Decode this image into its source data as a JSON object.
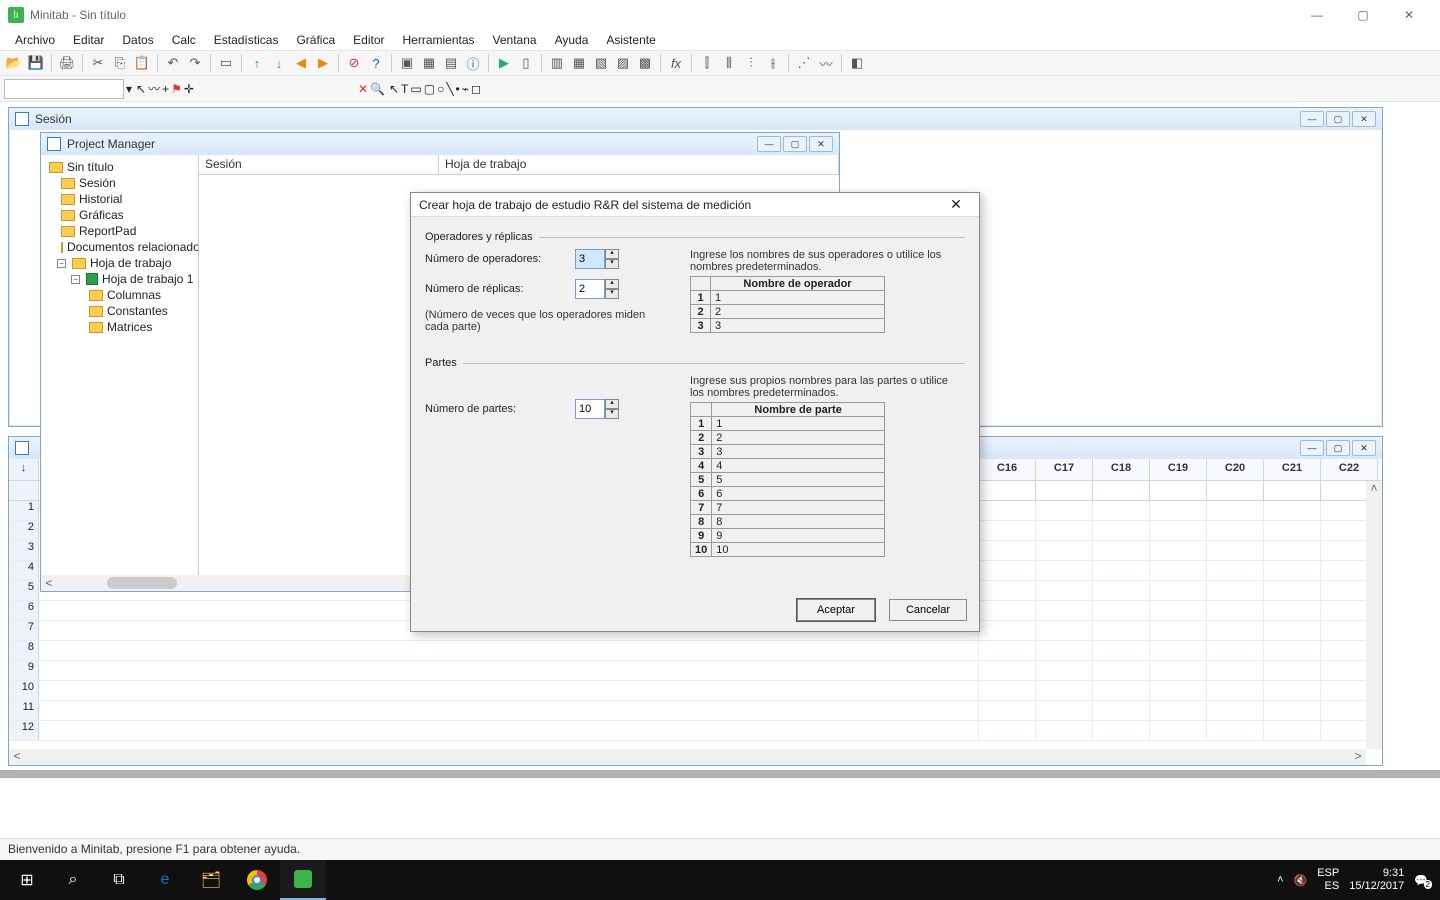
{
  "titlebar": {
    "app": "Minitab",
    "doc": "Sin título"
  },
  "menu": [
    "Archivo",
    "Editar",
    "Datos",
    "Calc",
    "Estadísticas",
    "Gráfica",
    "Editor",
    "Herramientas",
    "Ventana",
    "Ayuda",
    "Asistente"
  ],
  "session": {
    "title": "Sesión"
  },
  "project_manager": {
    "title": "Project Manager",
    "columns": [
      "Sesión",
      "Hoja de trabajo"
    ],
    "tree": {
      "root": "Sin título",
      "n1": "Sesión",
      "n2": "Historial",
      "n3": "Gráficas",
      "n4": "ReportPad",
      "n5": "Documentos relacionados",
      "n6": "Hoja de trabajo",
      "n6a": "Hoja de trabajo 1",
      "n6a1": "Columnas",
      "n6a2": "Constantes",
      "n6a3": "Matrices"
    }
  },
  "worksheet": {
    "cols": [
      "C16",
      "C17",
      "C18",
      "C19",
      "C20",
      "C21",
      "C22"
    ],
    "rows": [
      "1",
      "2",
      "3",
      "4",
      "5",
      "6",
      "7",
      "8",
      "9",
      "10",
      "11",
      "12"
    ]
  },
  "dialog": {
    "title": "Crear hoja de trabajo de estudio R&R del sistema de medición",
    "section1": "Operadores y réplicas",
    "num_operators_label": "Número de operadores:",
    "num_operators": "3",
    "num_replicas_label": "Número de réplicas:",
    "num_replicas": "2",
    "replicas_note": "(Número de veces que los operadores miden cada parte)",
    "operators_hint": "Ingrese los nombres de sus operadores o utilice los nombres predeterminados.",
    "operator_header": "Nombre de operador",
    "operators": [
      "1",
      "2",
      "3"
    ],
    "section2": "Partes",
    "num_parts_label": "Número de partes:",
    "num_parts": "10",
    "parts_hint": "Ingrese sus propios nombres para las partes o utilice los nombres predeterminados.",
    "parts_header": "Nombre de parte",
    "parts": [
      "1",
      "2",
      "3",
      "4",
      "5",
      "6",
      "7",
      "8",
      "9",
      "10"
    ],
    "accept": "Aceptar",
    "cancel": "Cancelar"
  },
  "statusbar": "Bienvenido a Minitab, presione F1 para obtener ayuda.",
  "taskbar": {
    "lang": "ESP",
    "lang2": "ES",
    "time": "9:31",
    "date": "15/12/2017",
    "notif": "2"
  }
}
